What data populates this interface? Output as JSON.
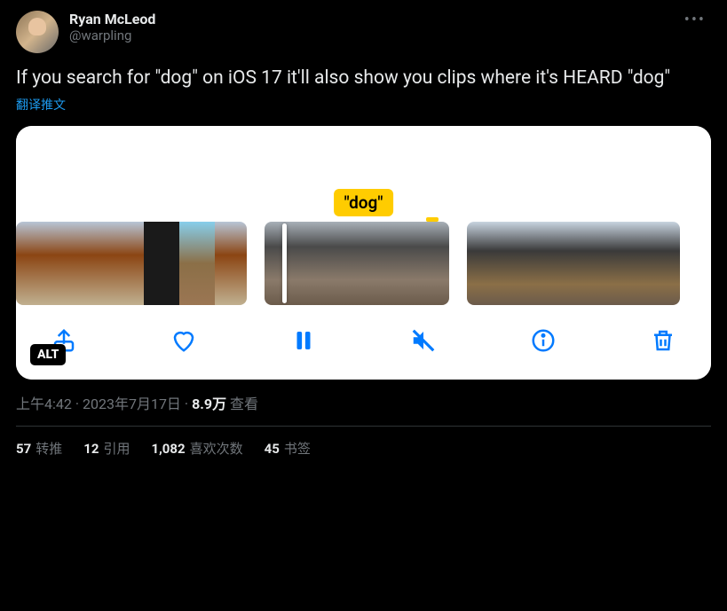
{
  "author": {
    "display_name": "Ryan McLeod",
    "handle": "@warpling"
  },
  "more_icon_label": "more",
  "body_text": "If you search for \"dog\" on iOS 17 it'll also show you clips where it's HEARD \"dog\"",
  "translate_link": "翻译推文",
  "media": {
    "badge_text": "\"dog\"",
    "alt_badge": "ALT",
    "toolbar": {
      "share": "share",
      "like": "like",
      "pause": "pause",
      "mute": "mute",
      "info": "info",
      "delete": "delete"
    }
  },
  "meta": {
    "time": "上午4:42",
    "dot1": " · ",
    "date": "2023年7月17日",
    "dot2": " · ",
    "views_count": "8.9万",
    "views_label": " 查看"
  },
  "stats": {
    "retweets": {
      "count": "57",
      "label": "转推"
    },
    "quotes": {
      "count": "12",
      "label": "引用"
    },
    "likes": {
      "count": "1,082",
      "label": "喜欢次数"
    },
    "bookmarks": {
      "count": "45",
      "label": "书签"
    }
  }
}
